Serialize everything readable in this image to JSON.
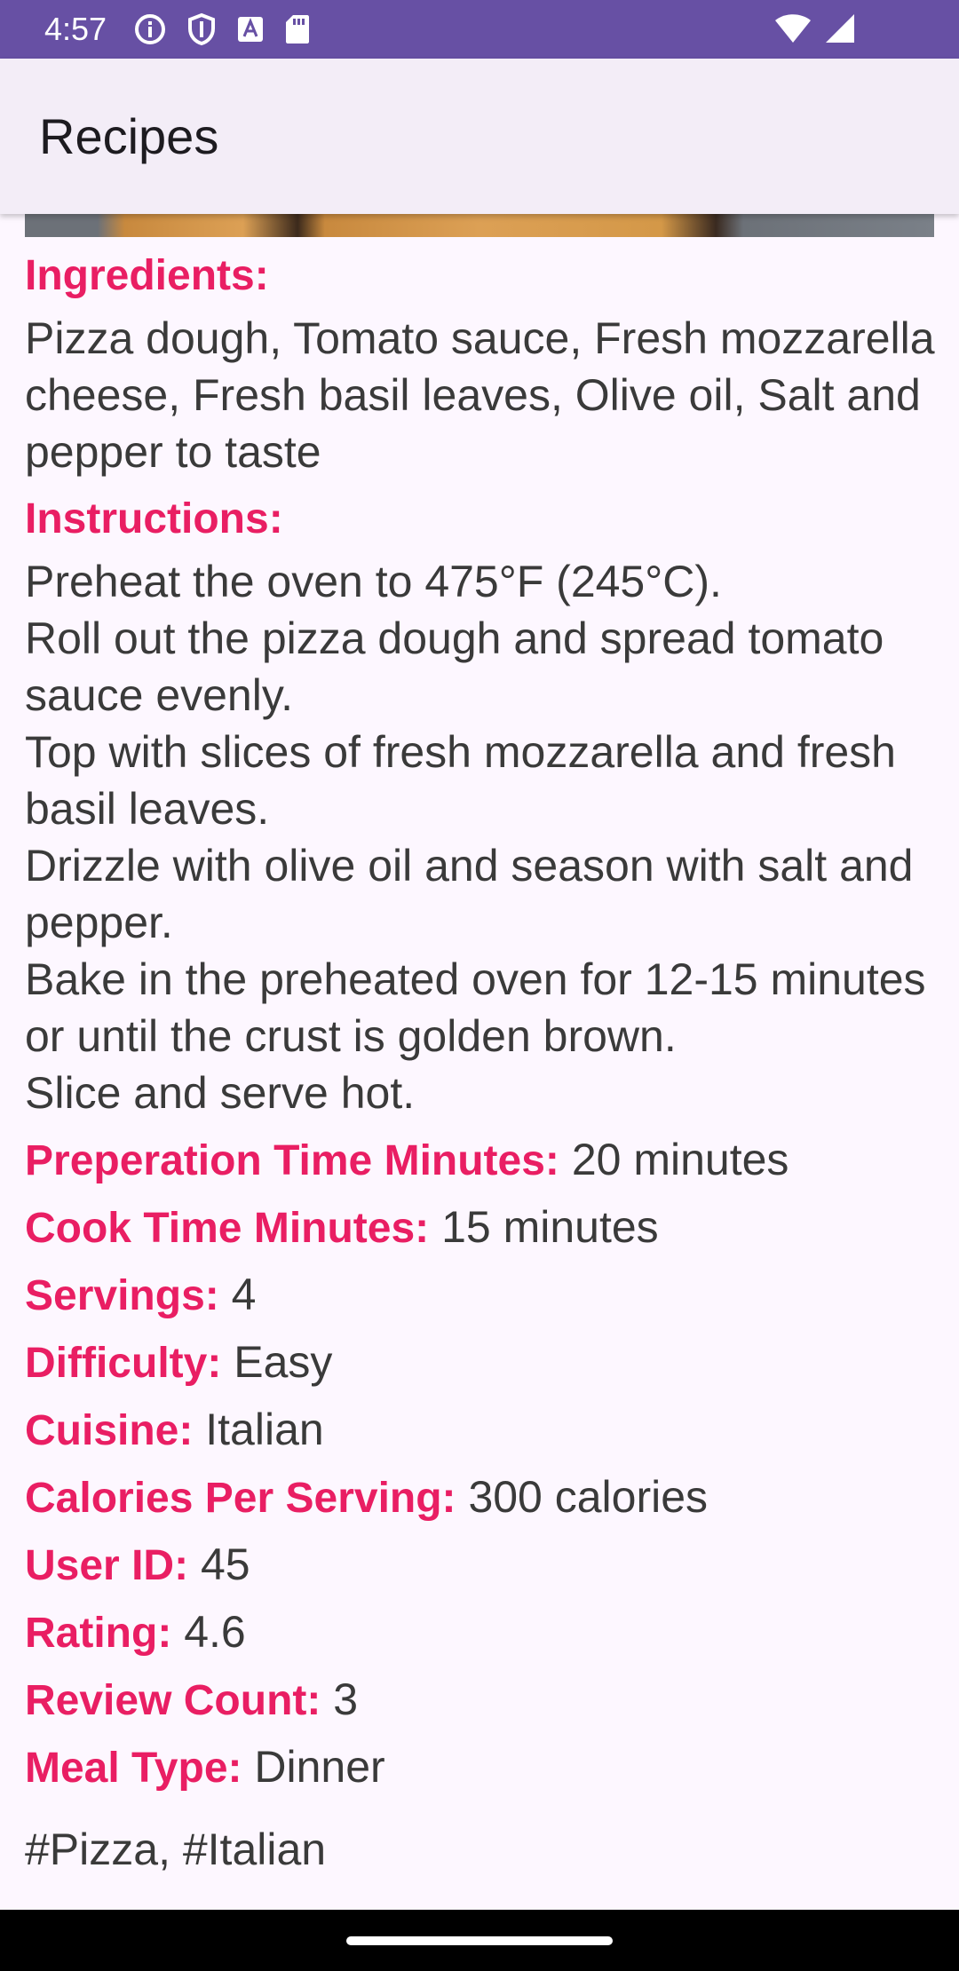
{
  "status_bar": {
    "time": "4:57",
    "left_icons": [
      "info-icon",
      "shield-icon",
      "font-icon",
      "sd-card-icon"
    ],
    "right_icons": [
      "wifi-icon",
      "signal-icon"
    ],
    "background": "#6750a4"
  },
  "app_bar": {
    "title": "Recipes"
  },
  "recipe": {
    "ingredients_label": "Ingredients:",
    "ingredients": "Pizza dough, Tomato sauce, Fresh mozzarella cheese, Fresh basil leaves, Olive oil, Salt and pepper to taste",
    "instructions_label": "Instructions:",
    "instructions": [
      "Preheat the oven to 475°F (245°C).",
      "Roll out the pizza dough and spread tomato sauce evenly.",
      "Top with slices of fresh mozzarella and fresh basil leaves.",
      "Drizzle with olive oil and season with salt and pepper.",
      "Bake in the preheated oven for 12-15 minutes or until the crust is golden brown.",
      "Slice and serve hot."
    ],
    "fields": {
      "prep_time": {
        "label": "Preperation Time Minutes:",
        "value": "20 minutes"
      },
      "cook_time": {
        "label": "Cook Time Minutes:",
        "value": "15 minutes"
      },
      "servings": {
        "label": "Servings:",
        "value": "4"
      },
      "difficulty": {
        "label": "Difficulty:",
        "value": "Easy"
      },
      "cuisine": {
        "label": "Cuisine:",
        "value": "Italian"
      },
      "calories": {
        "label": "Calories Per Serving:",
        "value": "300 calories"
      },
      "user_id": {
        "label": "User ID:",
        "value": "45"
      },
      "rating": {
        "label": "Rating:",
        "value": "4.6"
      },
      "review_count": {
        "label": "Review Count:",
        "value": "3"
      },
      "meal_type": {
        "label": "Meal Type:",
        "value": "Dinner"
      }
    },
    "tags": "#Pizza, #Italian"
  },
  "colors": {
    "accent": "#e91e63",
    "body_text": "#3a3a3a",
    "background": "#fdf7ff",
    "app_bar": "#f3edf7"
  }
}
